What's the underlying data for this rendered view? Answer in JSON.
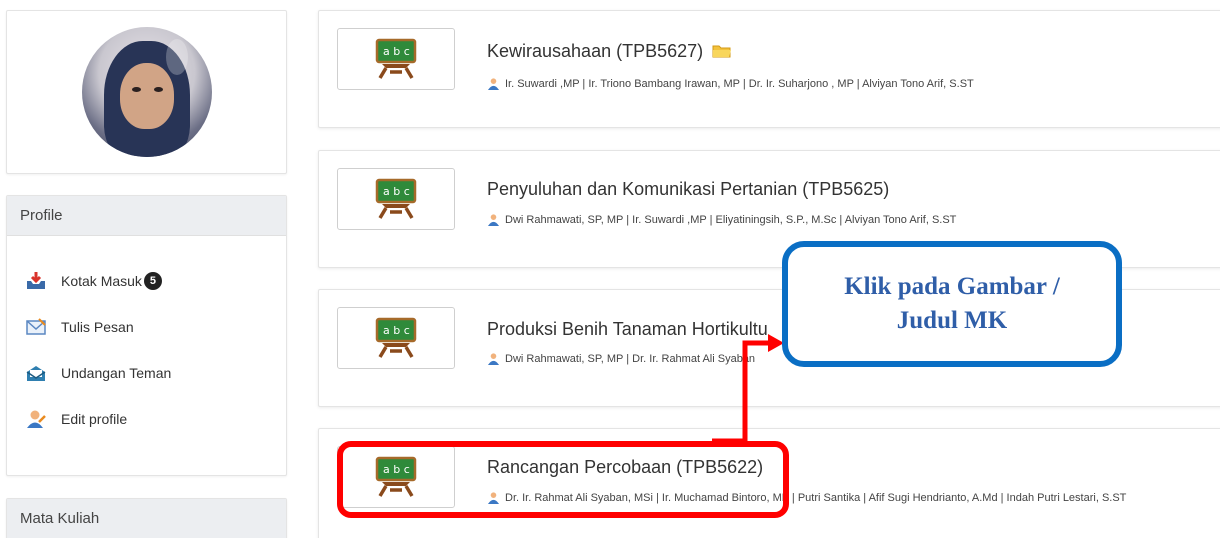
{
  "sidebar": {
    "profile_header": "Profile",
    "menu": [
      {
        "label": "Kotak Masuk",
        "icon": "inbox-icon",
        "badge": "5"
      },
      {
        "label": "Tulis Pesan",
        "icon": "envelope-icon"
      },
      {
        "label": "Undangan Teman",
        "icon": "invitation-icon"
      },
      {
        "label": "Edit profile",
        "icon": "user-edit-icon"
      }
    ],
    "courses_header": "Mata Kuliah"
  },
  "courses": [
    {
      "title": "Kewirausahaan (TPB5627)",
      "has_folder_icon": true,
      "lecturers": "Ir. Suwardi ,MP | Ir. Triono Bambang Irawan, MP | Dr. Ir. Suharjono , MP | Alviyan Tono Arif, S.ST"
    },
    {
      "title": "Penyuluhan dan Komunikasi Pertanian (TPB5625)",
      "lecturers": "Dwi Rahmawati, SP, MP | Ir. Suwardi ,MP | Eliyatiningsih, S.P., M.Sc | Alviyan Tono Arif, S.ST"
    },
    {
      "title": "Produksi Benih Tanaman Hortikultu",
      "lecturers": "Dwi Rahmawati, SP, MP | Dr. Ir. Rahmat Ali Syaban"
    },
    {
      "title": "Rancangan Percobaan (TPB5622)",
      "lecturers": "Dr. Ir. Rahmat Ali Syaban, MSi | Ir. Muchamad Bintoro, MP | Putri Santika | Afif Sugi Hendrianto, A.Md | Indah Putri Lestari, S.ST"
    }
  ],
  "callout": {
    "line1": "Klik pada Gambar /",
    "line2": "Judul MK"
  },
  "colors": {
    "callout_border": "#0a6ec4",
    "callout_text": "#2f5ea8",
    "highlight": "#ff0000",
    "panel_header": "#eceef1"
  },
  "icons": {
    "course_thumb": "chalkboard-abc-icon",
    "lecturer": "person-icon",
    "folder": "folder-icon"
  }
}
